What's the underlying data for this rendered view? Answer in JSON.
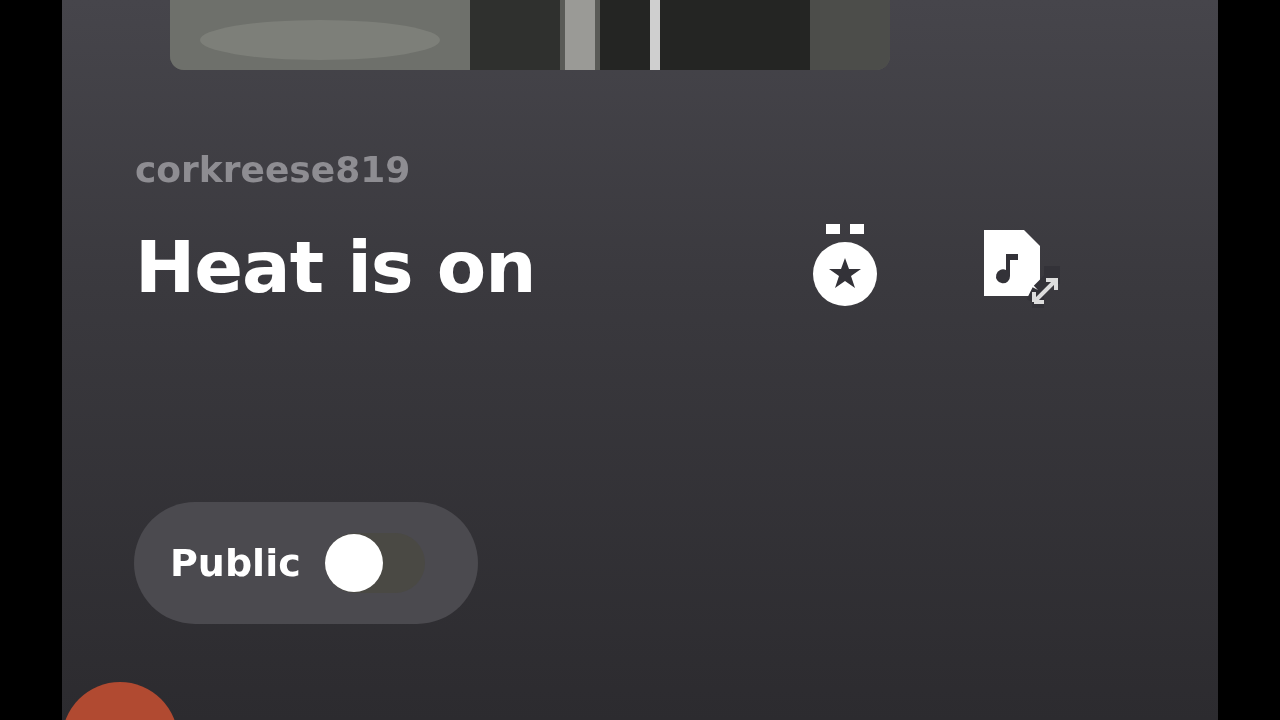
{
  "track": {
    "username": "corkreese819",
    "title": "Heat is on"
  },
  "visibility": {
    "label": "Public",
    "on": false
  }
}
